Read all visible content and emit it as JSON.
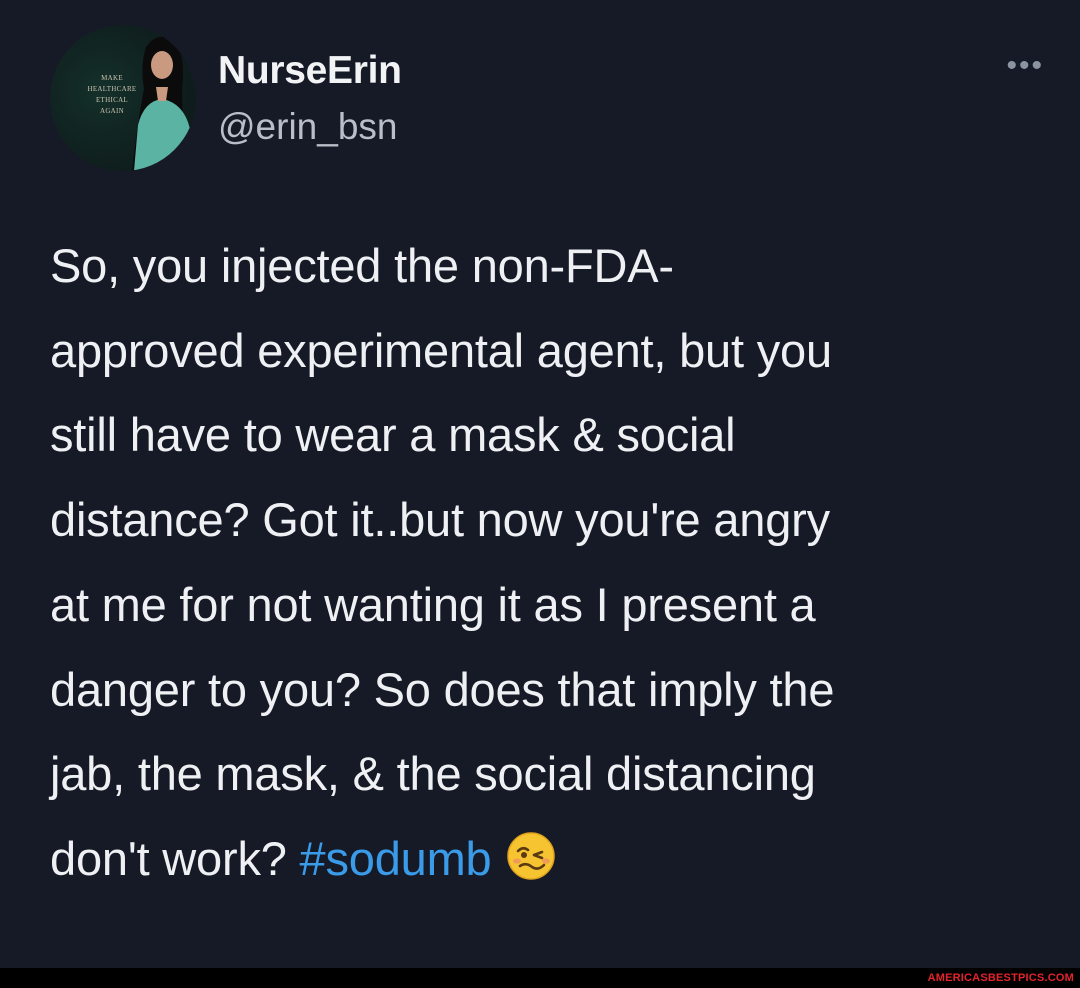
{
  "author": {
    "display_name": "NurseErin",
    "handle": "@erin_bsn",
    "avatar_text": [
      "MAKE",
      "HEALTHCARE",
      "ETHICAL",
      "AGAIN"
    ]
  },
  "more_icon": "more-options-icon",
  "tweet": {
    "lines": [
      "So, you injected the non-FDA-",
      "approved experimental agent, but you",
      "still have to wear a mask & social",
      "distance? Got it..but now you're angry",
      "at me for not wanting it as I present a",
      "danger to you?  So does that imply the",
      "jab, the mask, & the social distancing"
    ],
    "last_line_text": "don't work? ",
    "hashtag": "#sodumb",
    "emoji": "woozy-face-emoji"
  },
  "watermark": "AMERICASBESTPICS.COM",
  "colors": {
    "background": "#161a26",
    "hashtag": "#3a9be9",
    "watermark": "#e4232b"
  }
}
